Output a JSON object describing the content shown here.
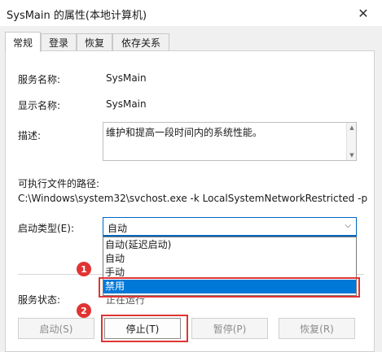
{
  "window": {
    "title": "SysMain 的属性(本地计算机)",
    "close_glyph": "✕"
  },
  "tabs": [
    {
      "label": "常规",
      "active": true
    },
    {
      "label": "登录",
      "active": false
    },
    {
      "label": "恢复",
      "active": false
    },
    {
      "label": "依存关系",
      "active": false
    }
  ],
  "general": {
    "service_name_label": "服务名称:",
    "service_name_value": "SysMain",
    "display_name_label": "显示名称:",
    "display_name_value": "SysMain",
    "description_label": "描述:",
    "description_value": "维护和提高一段时间内的系统性能。",
    "path_label": "可执行文件的路径:",
    "path_value": "C:\\Windows\\system32\\svchost.exe -k LocalSystemNetworkRestricted -p",
    "startup_type_label": "启动类型(E):",
    "startup_type_value": "自动",
    "startup_options": [
      "自动(延迟启动)",
      "自动",
      "手动",
      "禁用"
    ],
    "startup_selected_option": "禁用",
    "status_label": "服务状态:",
    "status_value": "正在运行"
  },
  "buttons": {
    "start": "启动(S)",
    "stop": "停止(T)",
    "pause": "暂停(P)",
    "resume": "恢复(R)"
  },
  "annotations": {
    "step1": "1",
    "step2": "2",
    "highlight_color": "#e03434"
  },
  "colors": {
    "accent": "#0067c0",
    "selection": "#0078d7"
  }
}
